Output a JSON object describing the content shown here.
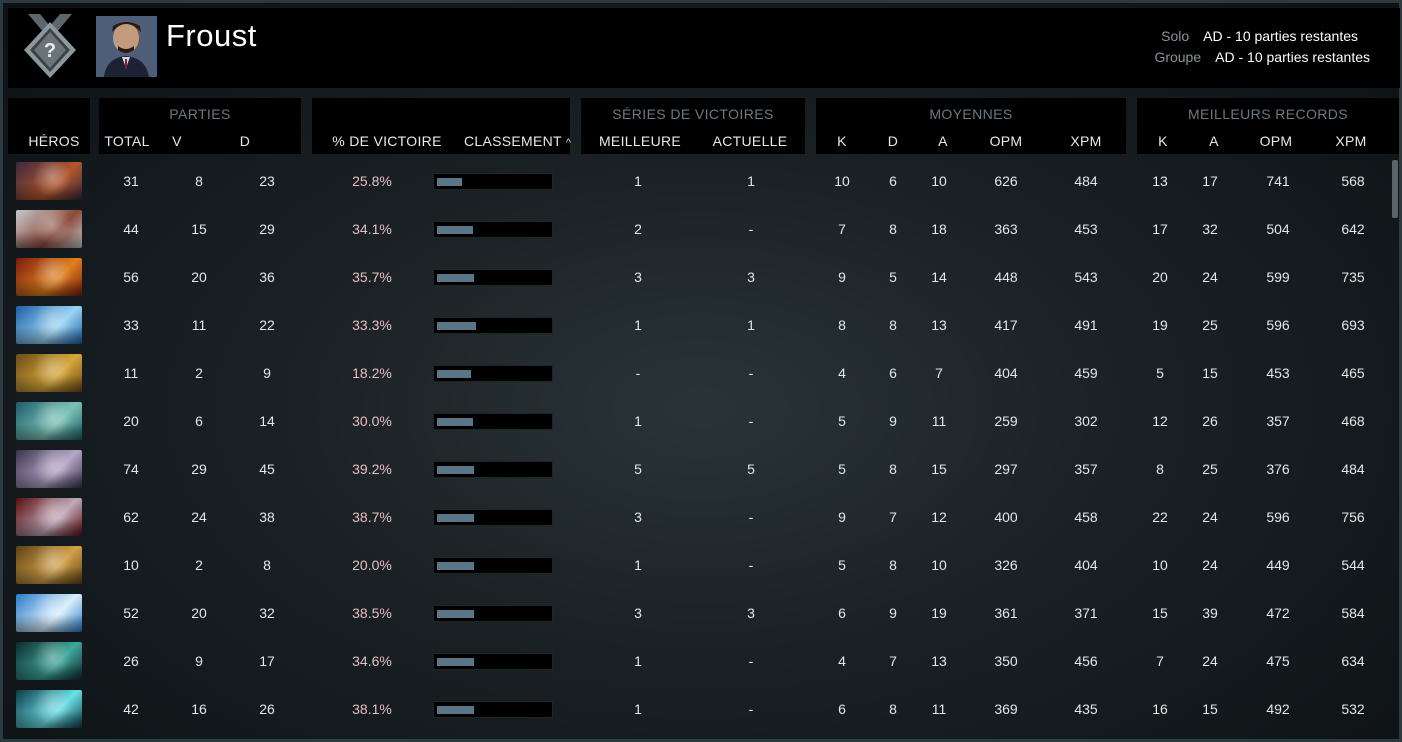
{
  "header": {
    "player_name": "Froust",
    "rank_badge": "?",
    "queues": [
      {
        "label": "Solo",
        "value": "AD - 10 parties restantes"
      },
      {
        "label": "Groupe",
        "value": "AD - 10 parties restantes"
      }
    ]
  },
  "columns": {
    "heroes": "HÉROS",
    "matches_group": "PARTIES",
    "total": "TOTAL",
    "wins": "V",
    "losses": "D",
    "win_pct": "% DE VICTOIRE",
    "ranking": "CLASSEMENT",
    "sort_icon": "^",
    "streaks_group": "SÉRIES DE VICTOIRES",
    "best": "MEILLEURE",
    "current": "ACTUELLE",
    "averages_group": "MOYENNES",
    "avg_k": "K",
    "avg_d": "D",
    "avg_a": "A",
    "avg_gpm": "OPM",
    "avg_xpm": "XPM",
    "records_group": "MEILLEURS RECORDS",
    "rec_k": "K",
    "rec_a": "A",
    "rec_gpm": "OPM",
    "rec_xpm": "XPM"
  },
  "rows": [
    {
      "hero_colors": [
        "#3b2740",
        "#b3562a"
      ],
      "total": "31",
      "wins": "8",
      "losses": "23",
      "win_pct": "25.8%",
      "rank_fill": 0.22,
      "best": "1",
      "current": "1",
      "avg_k": "10",
      "avg_d": "6",
      "avg_a": "10",
      "avg_gpm": "626",
      "avg_xpm": "484",
      "rec_k": "13",
      "rec_a": "17",
      "rec_gpm": "741",
      "rec_xpm": "568"
    },
    {
      "hero_colors": [
        "#c8c8cc",
        "#8c4a3a"
      ],
      "total": "44",
      "wins": "15",
      "losses": "29",
      "win_pct": "34.1%",
      "rank_fill": 0.32,
      "best": "2",
      "current": "-",
      "avg_k": "7",
      "avg_d": "8",
      "avg_a": "18",
      "avg_gpm": "363",
      "avg_xpm": "453",
      "rec_k": "17",
      "rec_a": "32",
      "rec_gpm": "504",
      "rec_xpm": "642"
    },
    {
      "hero_colors": [
        "#7a1c0c",
        "#e0801e"
      ],
      "total": "56",
      "wins": "20",
      "losses": "36",
      "win_pct": "35.7%",
      "rank_fill": 0.33,
      "best": "3",
      "current": "3",
      "avg_k": "9",
      "avg_d": "5",
      "avg_a": "14",
      "avg_gpm": "448",
      "avg_xpm": "543",
      "rec_k": "20",
      "rec_a": "24",
      "rec_gpm": "599",
      "rec_xpm": "735"
    },
    {
      "hero_colors": [
        "#1d5ea8",
        "#9ad4f2"
      ],
      "total": "33",
      "wins": "11",
      "losses": "22",
      "win_pct": "33.3%",
      "rank_fill": 0.35,
      "best": "1",
      "current": "1",
      "avg_k": "8",
      "avg_d": "8",
      "avg_a": "13",
      "avg_gpm": "417",
      "avg_xpm": "491",
      "rec_k": "19",
      "rec_a": "25",
      "rec_gpm": "596",
      "rec_xpm": "693"
    },
    {
      "hero_colors": [
        "#6b4a14",
        "#d8a83a"
      ],
      "total": "11",
      "wins": "2",
      "losses": "9",
      "win_pct": "18.2%",
      "rank_fill": 0.3,
      "best": "-",
      "current": "-",
      "avg_k": "4",
      "avg_d": "6",
      "avg_a": "7",
      "avg_gpm": "404",
      "avg_xpm": "459",
      "rec_k": "5",
      "rec_a": "15",
      "rec_gpm": "453",
      "rec_xpm": "465"
    },
    {
      "hero_colors": [
        "#1e5a6a",
        "#7ac4b6"
      ],
      "total": "20",
      "wins": "6",
      "losses": "14",
      "win_pct": "30.0%",
      "rank_fill": 0.32,
      "best": "1",
      "current": "-",
      "avg_k": "5",
      "avg_d": "9",
      "avg_a": "11",
      "avg_gpm": "259",
      "avg_xpm": "302",
      "rec_k": "12",
      "rec_a": "26",
      "rec_gpm": "357",
      "rec_xpm": "468"
    },
    {
      "hero_colors": [
        "#3a3450",
        "#b7a6c8"
      ],
      "total": "74",
      "wins": "29",
      "losses": "45",
      "win_pct": "39.2%",
      "rank_fill": 0.33,
      "best": "5",
      "current": "5",
      "avg_k": "5",
      "avg_d": "8",
      "avg_a": "15",
      "avg_gpm": "297",
      "avg_xpm": "357",
      "rec_k": "8",
      "rec_a": "25",
      "rec_gpm": "376",
      "rec_xpm": "484"
    },
    {
      "hero_colors": [
        "#5a0c10",
        "#c0a8b8"
      ],
      "total": "62",
      "wins": "24",
      "losses": "38",
      "win_pct": "38.7%",
      "rank_fill": 0.33,
      "best": "3",
      "current": "-",
      "avg_k": "9",
      "avg_d": "7",
      "avg_a": "12",
      "avg_gpm": "400",
      "avg_xpm": "458",
      "rec_k": "22",
      "rec_a": "24",
      "rec_gpm": "596",
      "rec_xpm": "756"
    },
    {
      "hero_colors": [
        "#5e4212",
        "#d2a04a"
      ],
      "total": "10",
      "wins": "2",
      "losses": "8",
      "win_pct": "20.0%",
      "rank_fill": 0.33,
      "best": "1",
      "current": "-",
      "avg_k": "5",
      "avg_d": "8",
      "avg_a": "10",
      "avg_gpm": "326",
      "avg_xpm": "404",
      "rec_k": "10",
      "rec_a": "24",
      "rec_gpm": "449",
      "rec_xpm": "544"
    },
    {
      "hero_colors": [
        "#2a7ac8",
        "#d8eefc"
      ],
      "total": "52",
      "wins": "20",
      "losses": "32",
      "win_pct": "38.5%",
      "rank_fill": 0.33,
      "best": "3",
      "current": "3",
      "avg_k": "6",
      "avg_d": "9",
      "avg_a": "19",
      "avg_gpm": "361",
      "avg_xpm": "371",
      "rec_k": "15",
      "rec_a": "39",
      "rec_gpm": "472",
      "rec_xpm": "584"
    },
    {
      "hero_colors": [
        "#0e2a2e",
        "#3fa89c"
      ],
      "total": "26",
      "wins": "9",
      "losses": "17",
      "win_pct": "34.6%",
      "rank_fill": 0.33,
      "best": "1",
      "current": "-",
      "avg_k": "4",
      "avg_d": "7",
      "avg_a": "13",
      "avg_gpm": "350",
      "avg_xpm": "456",
      "rec_k": "7",
      "rec_a": "24",
      "rec_gpm": "475",
      "rec_xpm": "634"
    },
    {
      "hero_colors": [
        "#0c3a48",
        "#6ae0e6"
      ],
      "total": "42",
      "wins": "16",
      "losses": "26",
      "win_pct": "38.1%",
      "rank_fill": 0.33,
      "best": "1",
      "current": "-",
      "avg_k": "6",
      "avg_d": "8",
      "avg_a": "11",
      "avg_gpm": "369",
      "avg_xpm": "435",
      "rec_k": "16",
      "rec_a": "15",
      "rec_gpm": "492",
      "rec_xpm": "532"
    }
  ],
  "colors": {
    "header_bg": "#000000",
    "win_pct_text": "#e8bfbf",
    "rank_bar": "#5a7585",
    "group_title": "#6d7880"
  }
}
